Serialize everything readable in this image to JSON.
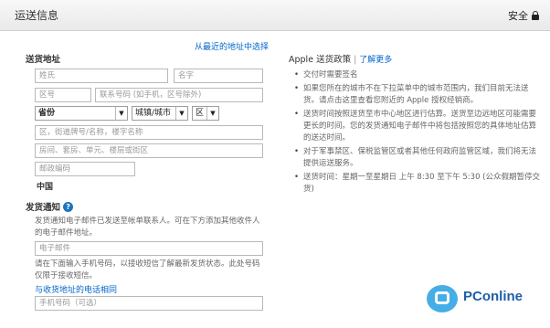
{
  "header": {
    "title": "运送信息",
    "secure_label": "安全"
  },
  "links": {
    "from_recent": "从最近的地址中选择",
    "vendor_privacy": "与收货地址的电话相同"
  },
  "shipping": {
    "section_label": "送货地址",
    "last_name_placeholder": "姓氏",
    "first_name_placeholder": "名字",
    "area_code_placeholder": "区号",
    "phone_placeholder": "联系号码 (如手机，区号除外)",
    "province_value": "省份",
    "city_value": "城镇/城市",
    "district_value": "区",
    "street_placeholder": "区，街道牌号/名称，楼字名称",
    "unit_placeholder": "房间、套房、单元、楼层或街区",
    "postal_placeholder": "邮政编码",
    "country": "中国"
  },
  "notification": {
    "section_label": "发货通知",
    "description": "发货通知电子邮件已发送至帐单联系人。可在下方添加其他收件人的电子邮件地址。",
    "email_placeholder": "电子邮件",
    "sms_description": "请在下面输入手机号码，以接收短信了解最新发货状态。此处号码仅限于接收短信。",
    "mobile_placeholder": "手机号码（可选）"
  },
  "policy": {
    "title": "Apple 送货政策",
    "learn_more": "了解更多",
    "bullets": [
      "交付时需要签名",
      "如果您所在的城市不在下拉菜单中的城市范围内，我们目前无法送货。请点击这里查看您附近的 Apple 授权经销商。",
      "送货时间按照送货至市中心地区进行估算。送货至边远地区可能需要更长的时间。您的发货通知电子邮件中将包括按照您的具体地址估算的送达时间。",
      "对于军事禁区、保税监管区或者其他任何政府监管区域，我们将无法提供运送服务。",
      "送货时间：星期一至星期日 上午 8:30 至下午 5:30 (公众假期暂停交货)"
    ]
  },
  "watermark": {
    "text": "PConline"
  },
  "colors": {
    "link": "#0066cc",
    "header_bg": "#eeeeee",
    "help_icon": "#1e73be",
    "watermark_blue": "#45aee6"
  },
  "icons": {
    "secure": "lock-icon",
    "notification_help": "help-icon",
    "watermark": "pconline-logo"
  }
}
